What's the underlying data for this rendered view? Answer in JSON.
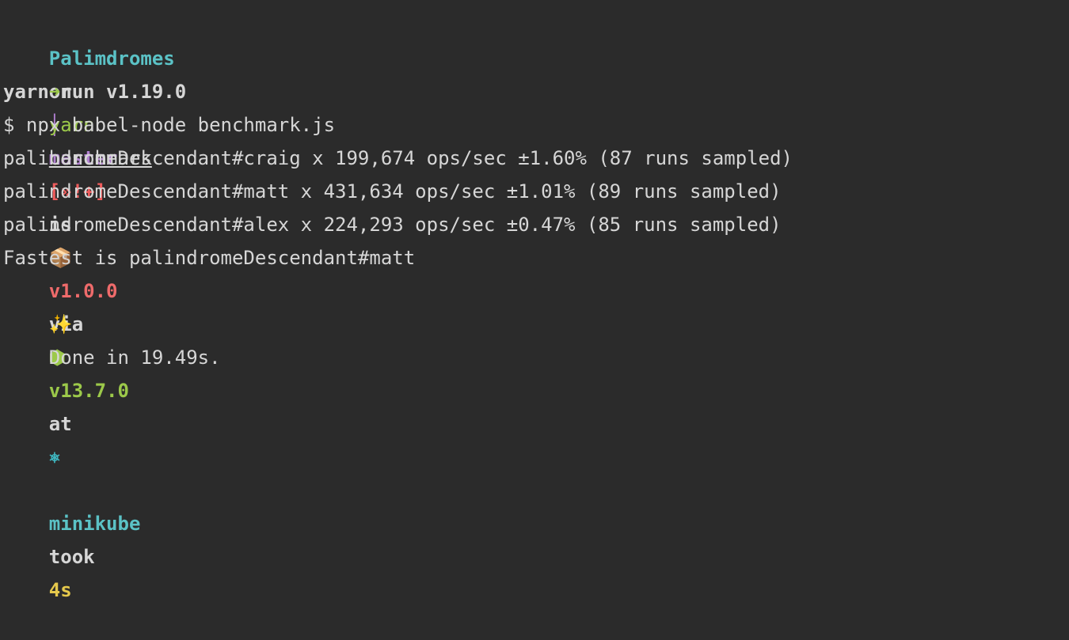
{
  "colors": {
    "background": "#2b2b2b",
    "text": "#d6d6d6",
    "dir": "#5bc2c6",
    "git_branch": "#b07fd0",
    "git_status": "#ef5c5c",
    "pkg_version": "#ef6b6b",
    "node": "#9cc94a",
    "k8s": "#3fb7c0",
    "took": "#e6c94c",
    "arrow": "#9cc94a"
  },
  "prompt": {
    "directory": "Palimdromes",
    "on": "on",
    "branch_icon": "│",
    "branch": "master",
    "git_status": "[»!+]",
    "is": "is",
    "package_icon": "📦",
    "package_version": "v1.0.0",
    "via": "via",
    "node_icon": "⬢",
    "node_version": "v13.7.0",
    "at": "at",
    "k8s_icon": "⎈",
    "k8s_context": "minikube",
    "took": "took",
    "duration": "4s"
  },
  "command": {
    "arrow": "➜",
    "cmd": "yarn",
    "arg": "benchmark"
  },
  "output": {
    "yarn_version": "yarn run v1.19.0",
    "exec_line": "$ npx babel-node benchmark.js",
    "results": [
      "palindromeDescendant#craig x 199,674 ops/sec ±1.60% (87 runs sampled)",
      "palindromeDescendant#matt x 431,634 ops/sec ±1.01% (89 runs sampled)",
      "palindromeDescendant#alex x 224,293 ops/sec ±0.47% (85 runs sampled)"
    ],
    "fastest": "Fastest is palindromeDescendant#matt",
    "done_icon": "✨",
    "done": "Done in 19.49s."
  }
}
